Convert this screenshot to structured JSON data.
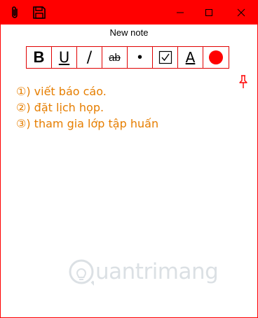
{
  "window": {
    "title": "New note",
    "accent_color": "#ff0000",
    "titlebar_icons": [
      "paperclip-icon",
      "save-icon"
    ],
    "controls": [
      "minimize-icon",
      "maximize-icon",
      "close-icon"
    ]
  },
  "toolbar": {
    "bold": "B",
    "underline": "U",
    "italic": "/",
    "strikethrough": "ab",
    "bullet": "•",
    "font": "A",
    "checkbox_icon": "checkbox-icon",
    "color_icon": "color-dot-icon",
    "color": "#ff0000"
  },
  "note": {
    "text_color": "#e67e00",
    "lines": [
      "①) viết báo cáo.",
      "②) đặt lịch họp.",
      "③) tham gia lớp tập huấn"
    ]
  },
  "pin": {
    "icon": "pin-icon"
  },
  "watermark": {
    "text": "uantrimang",
    "icon": "lightbulb-icon"
  }
}
